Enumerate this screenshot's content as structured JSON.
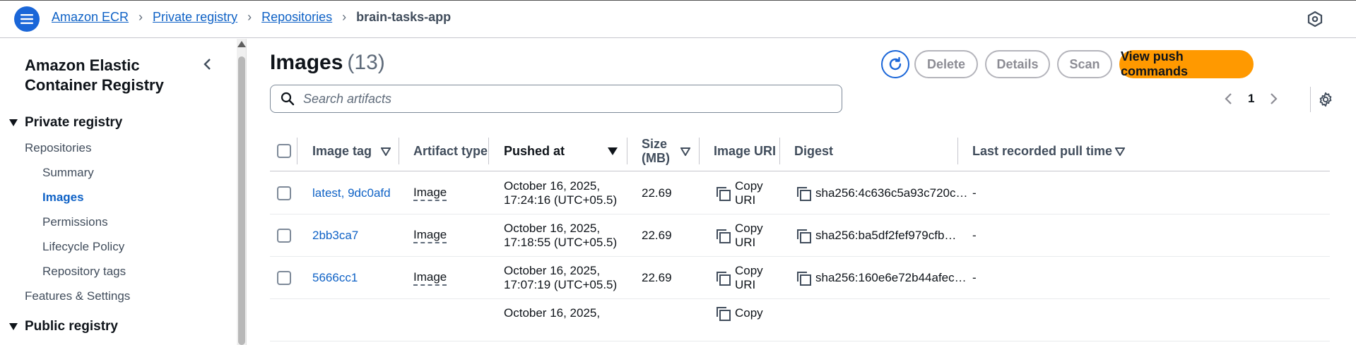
{
  "breadcrumbs": [
    "Amazon ECR",
    "Private registry",
    "Repositories",
    "brain-tasks-app"
  ],
  "sidebar": {
    "title": "Amazon Elastic Container Registry",
    "private_section": "Private registry",
    "items": [
      {
        "label": "Repositories"
      },
      {
        "label": "Summary"
      },
      {
        "label": "Images"
      },
      {
        "label": "Permissions"
      },
      {
        "label": "Lifecycle Policy"
      },
      {
        "label": "Repository tags"
      },
      {
        "label": "Features & Settings"
      }
    ],
    "public_section": "Public registry",
    "active_item": "Images"
  },
  "main": {
    "title": "Images",
    "count": "(13)",
    "buttons": {
      "delete": "Delete",
      "details": "Details",
      "scan": "Scan",
      "push": "View push commands"
    },
    "search": {
      "placeholder": "Search artifacts"
    },
    "pagination": {
      "page": "1"
    }
  },
  "table": {
    "columns": {
      "image_tag": "Image tag",
      "artifact_type": "Artifact type",
      "pushed_at": "Pushed at",
      "size_line1": "Size",
      "size_line2": "(MB)",
      "image_uri": "Image URI",
      "digest": "Digest",
      "last_pull": "Last recorded pull time"
    },
    "copy_line1": "Copy",
    "copy_line2": "URI",
    "rows": [
      {
        "tag": "latest, 9dc0afd",
        "type": "Image",
        "pushed_1": "October 16, 2025,",
        "pushed_2": "17:24:16 (UTC+05.5)",
        "size": "22.69",
        "digest": "sha256:4c636c5a93c720c…",
        "last_pull": "-"
      },
      {
        "tag": "2bb3ca7",
        "type": "Image",
        "pushed_1": "October 16, 2025,",
        "pushed_2": "17:18:55 (UTC+05.5)",
        "size": "22.69",
        "digest": "sha256:ba5df2fef979cfb…",
        "last_pull": "-"
      },
      {
        "tag": "5666cc1",
        "type": "Image",
        "pushed_1": "October 16, 2025,",
        "pushed_2": "17:07:19 (UTC+05.5)",
        "size": "22.69",
        "digest": "sha256:160e6e72b44afec…",
        "last_pull": "-"
      },
      {
        "tag": "",
        "type": "",
        "pushed_1": "October 16, 2025,",
        "pushed_2": "",
        "size": "",
        "digest": "",
        "last_pull": ""
      }
    ]
  },
  "colors": {
    "accent": "#0f62c6",
    "primary_button": "#ff9900",
    "menu_button": "#1a66d8"
  }
}
